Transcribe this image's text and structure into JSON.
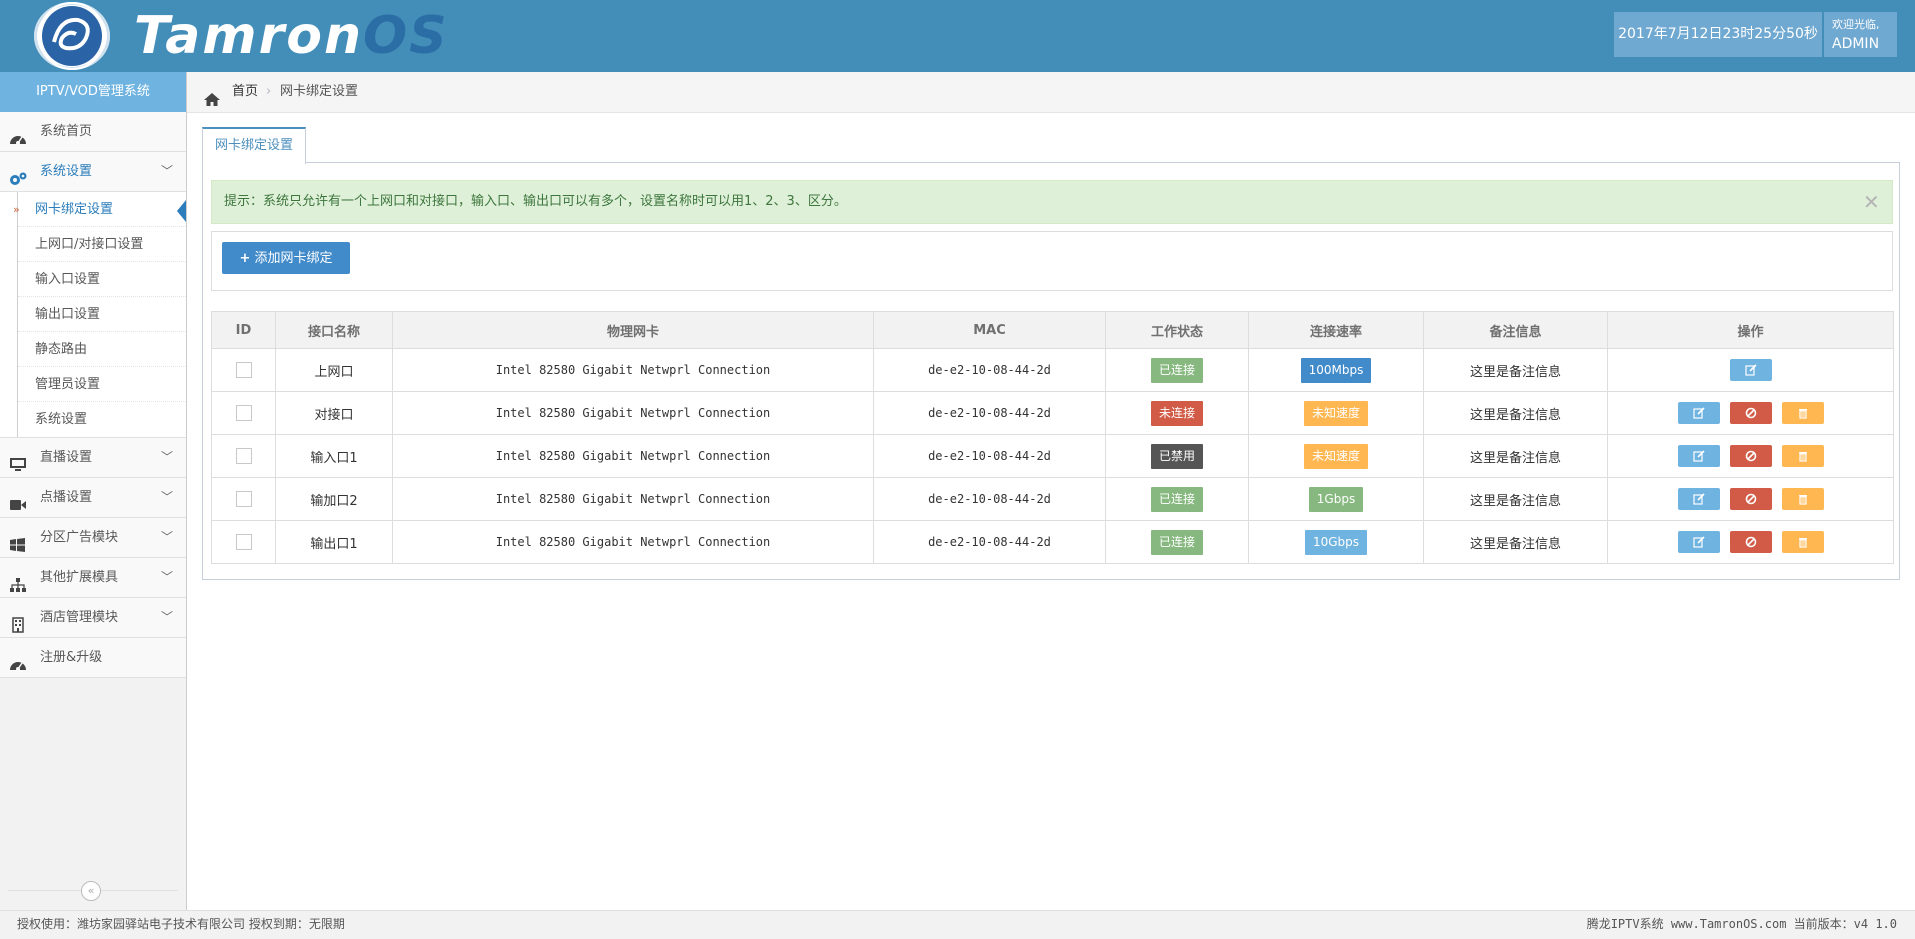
{
  "header": {
    "brand_part1": "Tamron",
    "brand_part2": "OS",
    "datetime": "2017年7月12日23时25分50秒",
    "welcome": "欢迎光临,",
    "user": "ADMIN",
    "colors": {
      "header_bg": "#438eb9",
      "accent": "#6fb3e0"
    }
  },
  "sidebar": {
    "title": "IPTV/VOD管理系统",
    "items": [
      {
        "label": "系统首页",
        "icon": "dashboard-icon",
        "expandable": false
      },
      {
        "label": "系统设置",
        "icon": "gears-icon",
        "expandable": true,
        "expanded": true,
        "children": [
          {
            "label": "网卡绑定设置",
            "active": true
          },
          {
            "label": "上网口/对接口设置"
          },
          {
            "label": "输入口设置"
          },
          {
            "label": "输出口设置"
          },
          {
            "label": "静态路由"
          },
          {
            "label": "管理员设置"
          },
          {
            "label": "系统设置"
          }
        ]
      },
      {
        "label": "直播设置",
        "icon": "desktop-icon",
        "expandable": true
      },
      {
        "label": "点播设置",
        "icon": "video-camera-icon",
        "expandable": true
      },
      {
        "label": "分区广告模块",
        "icon": "windows-icon",
        "expandable": true
      },
      {
        "label": "其他扩展模具",
        "icon": "sitemap-icon",
        "expandable": true
      },
      {
        "label": "酒店管理模块",
        "icon": "building-icon",
        "expandable": true
      },
      {
        "label": "注册&升级",
        "icon": "dashboard-icon",
        "expandable": false
      }
    ],
    "collapse_icon": "double-chevron-left-icon"
  },
  "breadcrumb": {
    "home": "首页",
    "current": "网卡绑定设置"
  },
  "tab": {
    "label": "网卡绑定设置"
  },
  "alert": {
    "text": "提示：系统只允许有一个上网口和对接口，输入口、输出口可以有多个，设置名称时可以用1、2、3、区分。"
  },
  "toolbar": {
    "add_label": "添加网卡绑定"
  },
  "table": {
    "columns": [
      "ID",
      "接口名称",
      "物理网卡",
      "MAC",
      "工作状态",
      "连接速率",
      "备注信息",
      "操作"
    ],
    "rows": [
      {
        "name": "上网口",
        "nic": "Intel 82580 Gigabit Netwprl Connection",
        "mac": "de-e2-10-08-44-2d",
        "status": "已连接",
        "status_color": "#87b87f",
        "speed": "100Mbps",
        "speed_color": "#428bca",
        "note": "这里是备注信息",
        "actions": [
          "edit"
        ]
      },
      {
        "name": "对接口",
        "nic": "Intel 82580 Gigabit Netwprl Connection",
        "mac": "de-e2-10-08-44-2d",
        "status": "未连接",
        "status_color": "#d15b47",
        "speed": "未知速度",
        "speed_color": "#ffb752",
        "note": "这里是备注信息",
        "actions": [
          "edit",
          "ban",
          "delete"
        ]
      },
      {
        "name": "输入口1",
        "nic": "Intel 82580 Gigabit Netwprl Connection",
        "mac": "de-e2-10-08-44-2d",
        "status": "已禁用",
        "status_color": "#555555",
        "speed": "未知速度",
        "speed_color": "#ffb752",
        "note": "这里是备注信息",
        "actions": [
          "edit",
          "ban",
          "delete"
        ]
      },
      {
        "name": "输加口2",
        "nic": "Intel 82580 Gigabit Netwprl Connection",
        "mac": "de-e2-10-08-44-2d",
        "status": "已连接",
        "status_color": "#87b87f",
        "speed": "1Gbps",
        "speed_color": "#87b87f",
        "note": "这里是备注信息",
        "actions": [
          "edit",
          "ban",
          "delete"
        ]
      },
      {
        "name": "输出口1",
        "nic": "Intel 82580 Gigabit Netwprl Connection",
        "mac": "de-e2-10-08-44-2d",
        "status": "已连接",
        "status_color": "#87b87f",
        "speed": "10Gbps",
        "speed_color": "#6fb3e0",
        "note": "这里是备注信息",
        "actions": [
          "edit",
          "ban",
          "delete"
        ]
      }
    ]
  },
  "footer": {
    "left": "授权使用：潍坊家园驿站电子技术有限公司 授权到期：无限期",
    "right": "腾龙IPTV系统 www.TamronOS.com 当前版本：v4 1.0"
  }
}
